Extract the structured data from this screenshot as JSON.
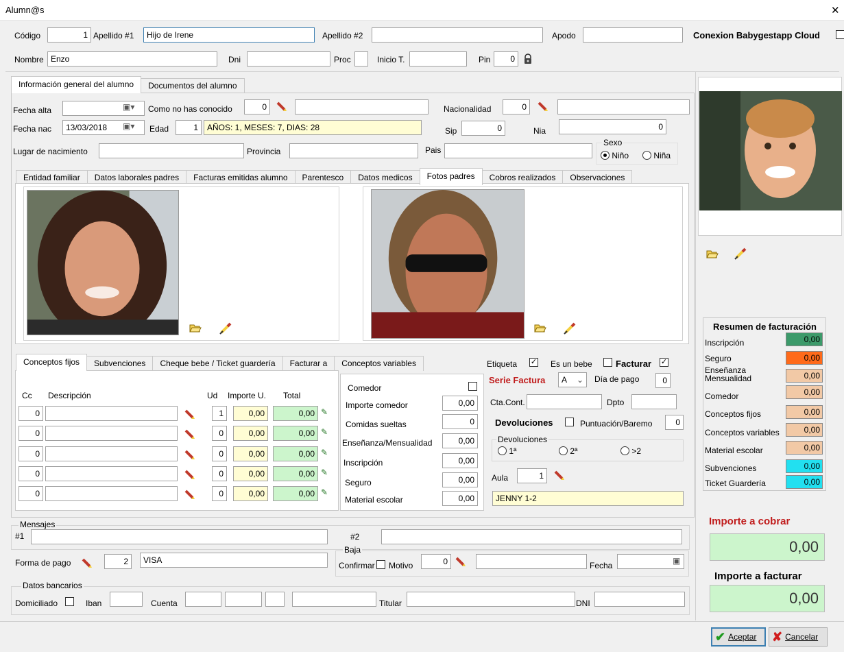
{
  "window": {
    "title": "Alumn@s",
    "close_glyph": "✕"
  },
  "header": {
    "codigo_label": "Código",
    "codigo_value": "1",
    "apellido1_label": "Apellido #1",
    "apellido1_value": "Hijo de Irene",
    "apellido2_label": "Apellido #2",
    "apellido2_value": "",
    "apodo_label": "Apodo",
    "apodo_value": "",
    "conexion_label": "Conexion Babygestapp Cloud",
    "nombre_label": "Nombre",
    "nombre_value": "Enzo",
    "dni_label": "Dni",
    "dni_value": "",
    "proc_label": "Proc",
    "proc_value": "",
    "inicio_label": "Inicio T.",
    "inicio_value": "",
    "pin_label": "Pin",
    "pin_value": "0"
  },
  "main_tabs": [
    "Información general del alumno",
    "Documentos del alumno"
  ],
  "general": {
    "fecha_alta_label": "Fecha alta",
    "fecha_alta_value": "",
    "como_label": "Como no has conocido",
    "como_code": "0",
    "como_value": "",
    "nacionalidad_label": "Nacionalidad",
    "nacionalidad_code": "0",
    "nacionalidad_value": "",
    "fecha_nac_label": "Fecha nac",
    "fecha_nac_value": "13/03/2018",
    "edad_label": "Edad",
    "edad_value": "1",
    "edad_text": "AÑOS: 1, MESES: 7, DIAS: 28",
    "sip_label": "Sip",
    "sip_value": "0",
    "nia_label": "Nia",
    "nia_value": "0",
    "lugar_label": "Lugar de nacimiento",
    "lugar_value": "",
    "provincia_label": "Provincia",
    "provincia_value": "",
    "pais_label": "Pais",
    "pais_value": "",
    "sexo_label": "Sexo",
    "sexo_options": [
      "Niño",
      "Niña"
    ],
    "sexo_selected": "Niño"
  },
  "sub_tabs": [
    "Entidad familiar",
    "Datos laborales padres",
    "Facturas emitidas alumno",
    "Parentesco",
    "Datos medicos",
    "Fotos padres",
    "Cobros realizados",
    "Observaciones"
  ],
  "sub_tab_active": "Fotos padres",
  "billing_tabs": [
    "Conceptos fijos",
    "Subvenciones",
    "Cheque bebe / Ticket guardería",
    "Facturar a",
    "Conceptos variables"
  ],
  "conceptos": {
    "headers": {
      "cc": "Cc",
      "descripcion": "Descripción",
      "ud": "Ud",
      "importe": "Importe U.",
      "total": "Total"
    },
    "rows": [
      {
        "cc": "0",
        "descripcion": "",
        "ud": "1",
        "importe": "0,00",
        "total": "0,00"
      },
      {
        "cc": "0",
        "descripcion": "",
        "ud": "0",
        "importe": "0,00",
        "total": "0,00"
      },
      {
        "cc": "0",
        "descripcion": "",
        "ud": "0",
        "importe": "0,00",
        "total": "0,00"
      },
      {
        "cc": "0",
        "descripcion": "",
        "ud": "0",
        "importe": "0,00",
        "total": "0,00"
      },
      {
        "cc": "0",
        "descripcion": "",
        "ud": "0",
        "importe": "0,00",
        "total": "0,00"
      }
    ]
  },
  "comedor": {
    "comedor_label": "Comedor",
    "items": [
      {
        "label": "Importe comedor",
        "value": "0,00"
      },
      {
        "label": "Comidas sueltas",
        "value": "0"
      },
      {
        "label": "Enseñanza/Mensualidad",
        "value": "0,00"
      },
      {
        "label": "Inscripción",
        "value": "0,00"
      },
      {
        "label": "Seguro",
        "value": "0,00"
      },
      {
        "label": "Material escolar",
        "value": "0,00"
      }
    ]
  },
  "factura": {
    "etiqueta_label": "Etiqueta",
    "bebe_label": "Es un bebe",
    "facturar_label": "Facturar",
    "serie_label": "Serie Factura",
    "serie_value": "A",
    "dia_label": "Día de pago",
    "dia_value": "0",
    "cta_label": "Cta.Cont.",
    "cta_value": "",
    "dpto_label": "Dpto",
    "dpto_value": "",
    "devoluciones_label": "Devoluciones",
    "puntuacion_label": "Puntuación/Baremo",
    "puntuacion_value": "0",
    "dev_group_label": "Devoluciones",
    "dev_options": [
      "1ª",
      "2ª",
      ">2"
    ],
    "aula_label": "Aula",
    "aula_value": "1",
    "aula_name": "JENNY 1-2"
  },
  "mensajes": {
    "label": "Mensajes",
    "m1_label": "#1",
    "m1_value": "",
    "m2_label": "#2",
    "m2_value": ""
  },
  "pago": {
    "label": "Forma de pago",
    "code": "2",
    "value": "VISA"
  },
  "baja": {
    "label": "Baja",
    "confirmar_label": "Confirmar",
    "motivo_label": "Motivo",
    "motivo_code": "0",
    "motivo_value": "",
    "fecha_label": "Fecha",
    "fecha_value": ""
  },
  "bancarios": {
    "label": "Datos bancarios",
    "domiciliado_label": "Domiciliado",
    "iban_label": "Iban",
    "cuenta_label": "Cuenta",
    "titular_label": "Titular",
    "dni_label": "DNI"
  },
  "resumen": {
    "title": "Resumen de facturación",
    "items": [
      {
        "label": "Inscripción",
        "value": "0,00",
        "color": "#3c9a6a"
      },
      {
        "label": "Seguro",
        "value": "0,00",
        "color": "#ff6a1a"
      },
      {
        "label": "Enseñanza\nMensualidad",
        "value": "0,00",
        "color": "#f2c9a6"
      },
      {
        "label": "Comedor",
        "value": "0,00",
        "color": "#f2c9a6"
      },
      {
        "label": "Conceptos fijos",
        "value": "0,00",
        "color": "#f2c9a6"
      },
      {
        "label": "Conceptos variables",
        "value": "0,00",
        "color": "#f2c9a6"
      },
      {
        "label": "Material escolar",
        "value": "0,00",
        "color": "#f2c9a6"
      },
      {
        "label": "Subvenciones",
        "value": "0,00",
        "color": "#22e0f0"
      },
      {
        "label": "Ticket Guardería",
        "value": "0,00",
        "color": "#22e0f0"
      }
    ]
  },
  "importes": {
    "cobrar_label": "Importe a cobrar",
    "cobrar_value": "0,00",
    "facturar_label": "Importe a facturar",
    "facturar_value": "0,00"
  },
  "buttons": {
    "aceptar": "Aceptar",
    "cancelar": "Cancelar"
  },
  "icons": {
    "pencil": "pencil-icon",
    "folder": "folder-open-icon",
    "eraser": "eraser-icon",
    "lock": "lock-icon",
    "check": "check-icon",
    "cross": "cross-icon"
  }
}
